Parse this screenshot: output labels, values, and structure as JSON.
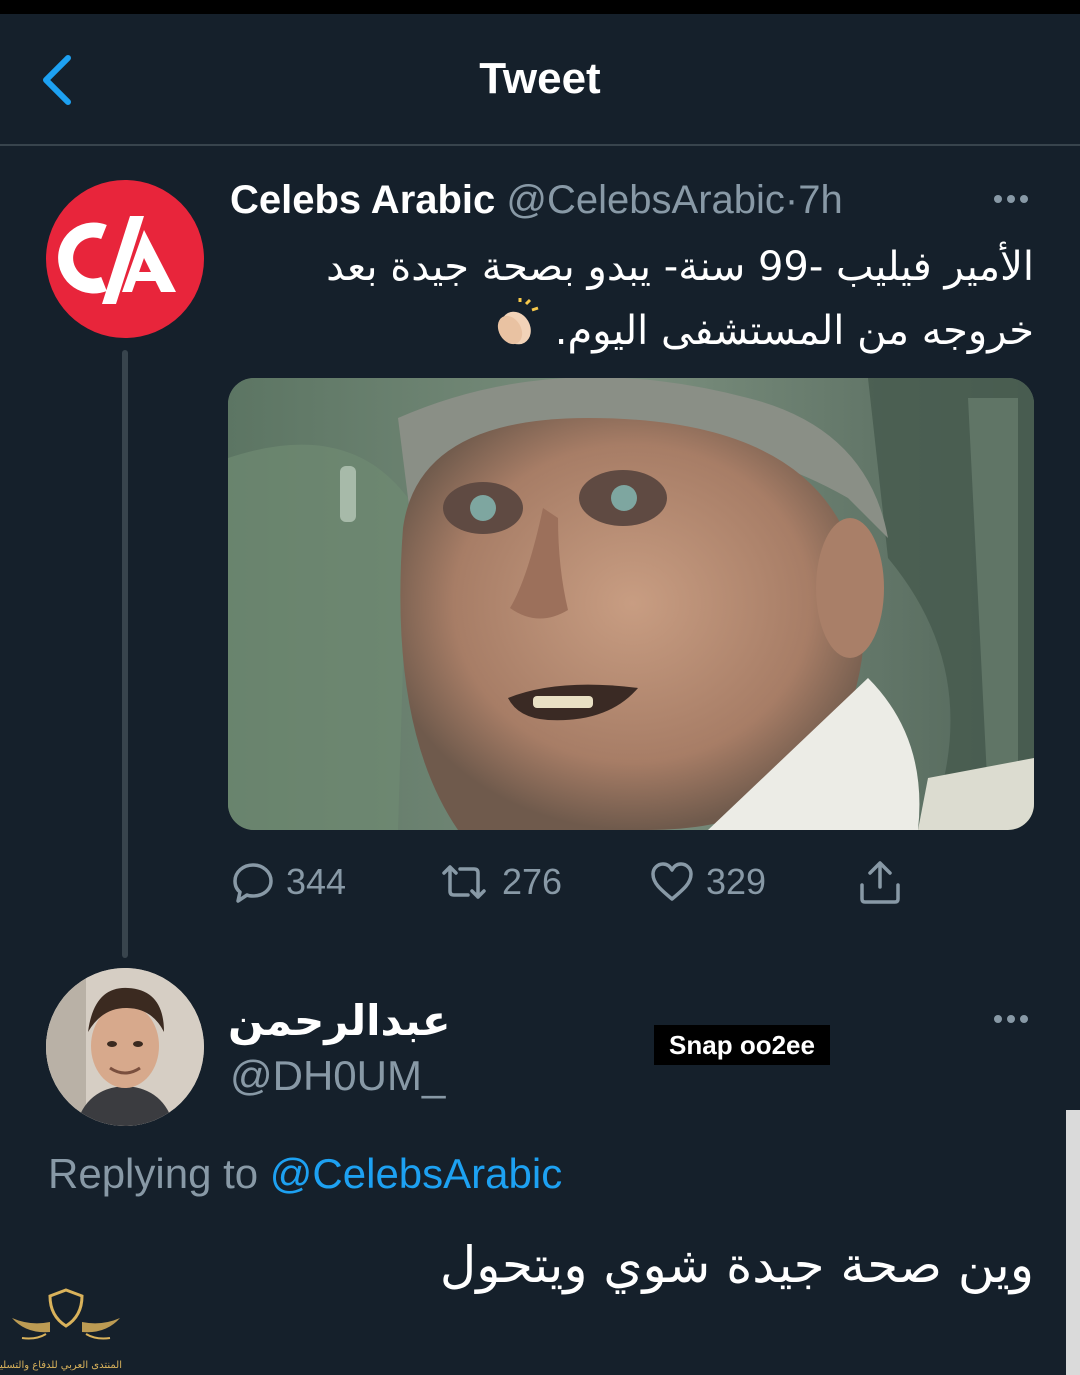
{
  "header": {
    "title": "Tweet",
    "back_icon": "chevron-left-icon"
  },
  "tweet": {
    "author_name": "Celebs Arabic",
    "handle": "@CelebsArabic",
    "separator": "·",
    "time": "7h",
    "avatar_text": "C/A",
    "text": "الأمير فيليب -99 سنة- يبدو بصحة جيدة بعد خروجه من المستشفى اليوم.",
    "emoji_icon": "clapping-hands-icon",
    "replies": "344",
    "retweets": "276",
    "likes": "329"
  },
  "reply": {
    "author_name": "عبدالرحمن",
    "handle": "@DH0UM_",
    "replying_prefix": "Replying to",
    "replying_to": "@CelebsArabic",
    "text": "وين صحة جيدة شوي ويتحول",
    "overlay_badge": "Snap oo2ee"
  },
  "watermark": {
    "text": "المنتدى العربي للدفاع والتسليح"
  },
  "colors": {
    "background": "#15202b",
    "accent": "#1da1f2",
    "muted": "#8899a6",
    "ca_brand": "#e8253b"
  }
}
